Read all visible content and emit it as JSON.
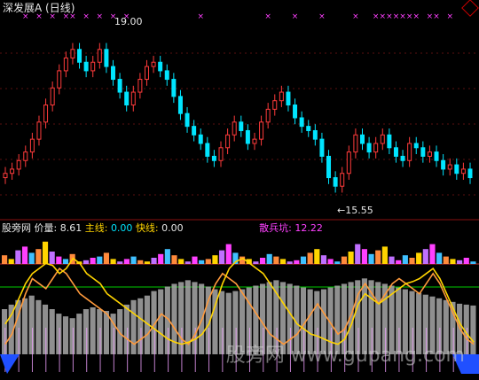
{
  "header": {
    "title": "深发展A (日线)"
  },
  "main_chart": {
    "high_label": "19.00",
    "low_label": "←15.55"
  },
  "indicator": {
    "name": "股旁网",
    "price_label": "价量:",
    "price_value": "8.61",
    "main_label": "主线:",
    "main_value": "0.00",
    "fast_label": "快线:",
    "fast_value": "0.00",
    "retail_label": "散兵坑:",
    "retail_value": "12.22"
  },
  "watermark": "股旁网 www.gupang.com",
  "colors": {
    "background": "#000000",
    "up_candle": "#ff3b3b",
    "down_candle": "#00e5ff",
    "marker": "#ff40ff",
    "main_line": "#ffd400",
    "fast_line": "#ff9a3c",
    "green_line": "#00cc00",
    "gray_bars": "#a8a8a8"
  },
  "chart_data": {
    "type": "candlestick",
    "ylim": [
      15.0,
      19.6
    ],
    "high_price": 19.0,
    "low_price": 15.55,
    "closes": [
      16.0,
      16.1,
      16.3,
      16.5,
      16.8,
      17.2,
      17.6,
      18.0,
      18.4,
      18.7,
      18.9,
      18.6,
      18.4,
      18.6,
      18.9,
      18.5,
      18.2,
      17.9,
      17.6,
      17.9,
      18.2,
      18.5,
      18.6,
      18.4,
      18.2,
      17.8,
      17.4,
      17.1,
      16.9,
      16.7,
      16.4,
      16.3,
      16.6,
      16.9,
      17.2,
      17.0,
      16.7,
      16.8,
      17.2,
      17.5,
      17.7,
      17.9,
      17.6,
      17.3,
      17.1,
      17.0,
      16.8,
      16.4,
      15.9,
      15.7,
      16.0,
      16.5,
      16.9,
      16.7,
      16.5,
      16.7,
      16.9,
      16.6,
      16.4,
      16.3,
      16.7,
      16.6,
      16.4,
      16.5,
      16.3,
      16.1,
      16.2,
      16.0,
      16.1,
      15.9
    ],
    "cross_markers": [
      3,
      5,
      7,
      9,
      10,
      12,
      14,
      16,
      18,
      29,
      39,
      43,
      47,
      52,
      55,
      56,
      57,
      58,
      59,
      60,
      61,
      63,
      64,
      66
    ],
    "indicator_bars": [
      0.35,
      0.2,
      0.55,
      0.7,
      0.45,
      0.6,
      0.9,
      0.5,
      0.3,
      0.2,
      0.4,
      0.1,
      0.15,
      0.25,
      0.3,
      0.45,
      0.2,
      0.1,
      0.2,
      0.3,
      0.15,
      0.1,
      0.25,
      0.4,
      0.6,
      0.35,
      0.2,
      0.1,
      0.3,
      0.15,
      0.2,
      0.35,
      0.55,
      0.8,
      0.45,
      0.3,
      0.2,
      0.1,
      0.25,
      0.4,
      0.3,
      0.2,
      0.1,
      0.15,
      0.3,
      0.45,
      0.6,
      0.35,
      0.2,
      0.1,
      0.3,
      0.5,
      0.8,
      0.6,
      0.4,
      0.55,
      0.7,
      0.3,
      0.15,
      0.35,
      0.25,
      0.45,
      0.6,
      0.8,
      0.45,
      0.3,
      0.2,
      0.15,
      0.25,
      0.1
    ],
    "gray_level": [
      0.5,
      0.55,
      0.6,
      0.62,
      0.65,
      0.6,
      0.55,
      0.5,
      0.45,
      0.42,
      0.4,
      0.45,
      0.5,
      0.52,
      0.5,
      0.48,
      0.45,
      0.5,
      0.55,
      0.6,
      0.62,
      0.65,
      0.7,
      0.72,
      0.75,
      0.78,
      0.8,
      0.82,
      0.8,
      0.78,
      0.75,
      0.72,
      0.7,
      0.68,
      0.7,
      0.72,
      0.74,
      0.76,
      0.78,
      0.8,
      0.82,
      0.8,
      0.78,
      0.76,
      0.74,
      0.72,
      0.7,
      0.72,
      0.74,
      0.76,
      0.78,
      0.8,
      0.82,
      0.84,
      0.82,
      0.8,
      0.78,
      0.76,
      0.74,
      0.72,
      0.7,
      0.68,
      0.66,
      0.64,
      0.62,
      0.6,
      0.58,
      0.56,
      0.55,
      0.54
    ],
    "main_line": [
      0.3,
      0.4,
      0.55,
      0.7,
      0.8,
      0.85,
      0.9,
      0.88,
      0.8,
      0.85,
      0.95,
      0.9,
      0.8,
      0.75,
      0.7,
      0.6,
      0.55,
      0.5,
      0.45,
      0.4,
      0.35,
      0.3,
      0.25,
      0.2,
      0.15,
      0.12,
      0.1,
      0.12,
      0.15,
      0.2,
      0.3,
      0.5,
      0.7,
      0.85,
      0.92,
      0.95,
      0.9,
      0.85,
      0.8,
      0.7,
      0.6,
      0.5,
      0.4,
      0.3,
      0.25,
      0.2,
      0.18,
      0.15,
      0.12,
      0.1,
      0.15,
      0.3,
      0.5,
      0.6,
      0.55,
      0.5,
      0.55,
      0.6,
      0.65,
      0.7,
      0.72,
      0.75,
      0.8,
      0.85,
      0.75,
      0.6,
      0.45,
      0.3,
      0.2,
      0.12
    ],
    "fast_line": [
      0.1,
      0.2,
      0.4,
      0.6,
      0.75,
      0.7,
      0.65,
      0.75,
      0.85,
      0.8,
      0.7,
      0.6,
      0.55,
      0.5,
      0.45,
      0.4,
      0.3,
      0.2,
      0.15,
      0.1,
      0.15,
      0.2,
      0.3,
      0.4,
      0.35,
      0.25,
      0.15,
      0.1,
      0.2,
      0.35,
      0.55,
      0.7,
      0.8,
      0.75,
      0.7,
      0.6,
      0.5,
      0.4,
      0.3,
      0.2,
      0.15,
      0.1,
      0.15,
      0.2,
      0.3,
      0.4,
      0.5,
      0.4,
      0.3,
      0.2,
      0.25,
      0.4,
      0.6,
      0.7,
      0.6,
      0.5,
      0.6,
      0.7,
      0.75,
      0.7,
      0.65,
      0.6,
      0.7,
      0.8,
      0.7,
      0.55,
      0.4,
      0.25,
      0.15,
      0.1
    ]
  }
}
